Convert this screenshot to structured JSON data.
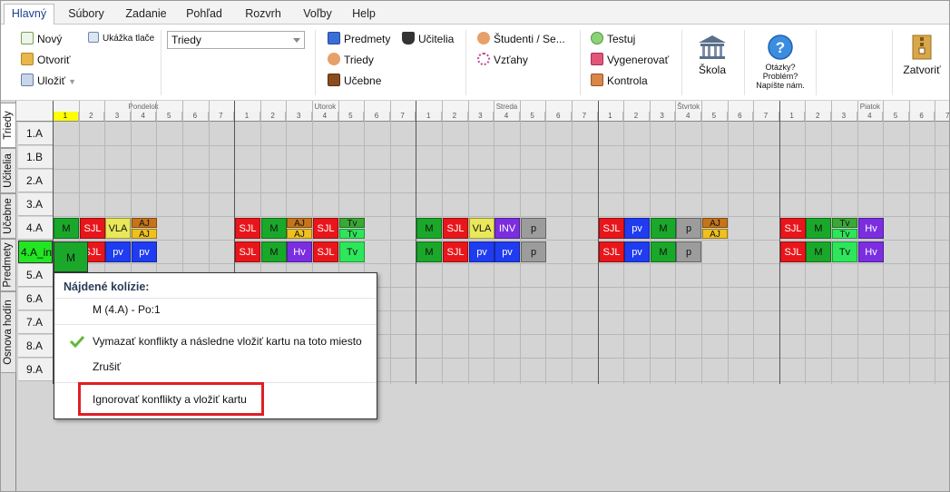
{
  "menu": {
    "items": [
      {
        "label": "Hlavný",
        "active": true
      },
      {
        "label": "Súbory"
      },
      {
        "label": "Zadanie"
      },
      {
        "label": "Pohľad"
      },
      {
        "label": "Rozvrh"
      },
      {
        "label": "Voľby"
      },
      {
        "label": "Help"
      }
    ]
  },
  "ribbon": {
    "new_label": "Nový",
    "print_preview_label": "Ukážka tlače",
    "open_label": "Otvoriť",
    "save_label": "Uložiť",
    "view_combo_value": "Triedy",
    "subjects_label": "Predmety",
    "teachers_label": "Učitelia",
    "classes_label": "Triedy",
    "classrooms_label": "Učebne",
    "students_label": "Študenti / Se...",
    "relations_label": "Vzťahy",
    "test_label": "Testuj",
    "generate_label": "Vygenerovať",
    "control_label": "Kontrola",
    "school_label": "Škola",
    "help_line1": "Otázky?",
    "help_line2": "Problém?",
    "help_line3": "Napíšte nám.",
    "close_label": "Zatvoriť"
  },
  "side_tabs": [
    {
      "label": "Triedy",
      "active": true
    },
    {
      "label": "Učitelia"
    },
    {
      "label": "Učebne"
    },
    {
      "label": "Predmety"
    },
    {
      "label": "Osnova hodín"
    }
  ],
  "timetable": {
    "days": [
      "Pondelok",
      "Utorok",
      "Streda",
      "Štvrtok",
      "Piatok"
    ],
    "periods": [
      "1",
      "2",
      "3",
      "4",
      "5",
      "6",
      "7"
    ],
    "highlighted_period": "1",
    "rows": [
      "1.A",
      "1.B",
      "2.A",
      "3.A",
      "4.A",
      "4.A_int",
      "5.A",
      "6.A",
      "7.A",
      "8.A",
      "9.A"
    ],
    "selected_row": "4.A_int",
    "dragged_card": "M"
  },
  "colors": {
    "M": "#1aa82a",
    "SJL": "#e8161b",
    "VLA": "#e8e85a",
    "AJ": "#c6741a",
    "Tv": "#2ee65a",
    "Hv": "#7b2ee0",
    "INV": "#7b2ee0",
    "p": "#9c9c9c",
    "pv": "#1f3cf0",
    "selected_row_bg": "#22e622",
    "highlight_period": "#ffff00",
    "alert": "#e01e26"
  },
  "collision_popup": {
    "title": "Nájdené kolízie:",
    "collision_item": "M (4.A) - Po:1",
    "option_delete": "Vymazať konflikty a následne vložiť kartu na toto miesto",
    "option_cancel": "Zrušiť",
    "option_ignore": "Ignorovať konflikty a vložiť kartu"
  }
}
